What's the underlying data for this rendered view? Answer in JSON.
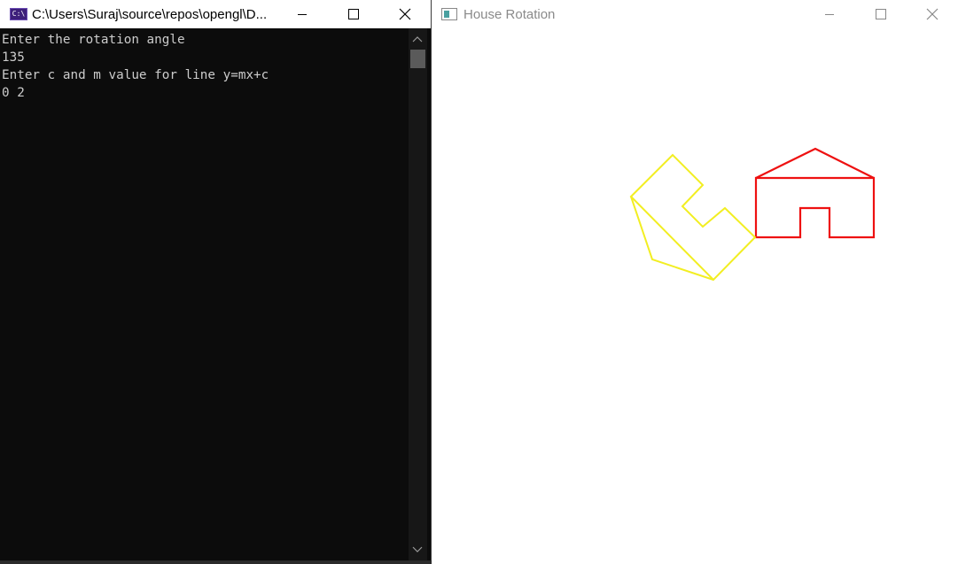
{
  "console": {
    "title": "C:\\Users\\Suraj\\source\\repos\\opengl\\D...",
    "icon": "console-app-icon",
    "icon_label": "C:\\",
    "lines": [
      "Enter the rotation angle",
      "135",
      "Enter c and m value for line y=mx+c",
      "0 2"
    ]
  },
  "gl_window": {
    "title": "House Rotation",
    "icon": "opengl-app-icon"
  },
  "controls": {
    "minimize": "minimize-icon",
    "maximize": "maximize-icon",
    "close": "close-icon"
  },
  "colors": {
    "original_house": "#ee1111",
    "rotated_house": "#f2ee22",
    "console_background": "#0c0c0c",
    "console_text": "#cccccc"
  }
}
